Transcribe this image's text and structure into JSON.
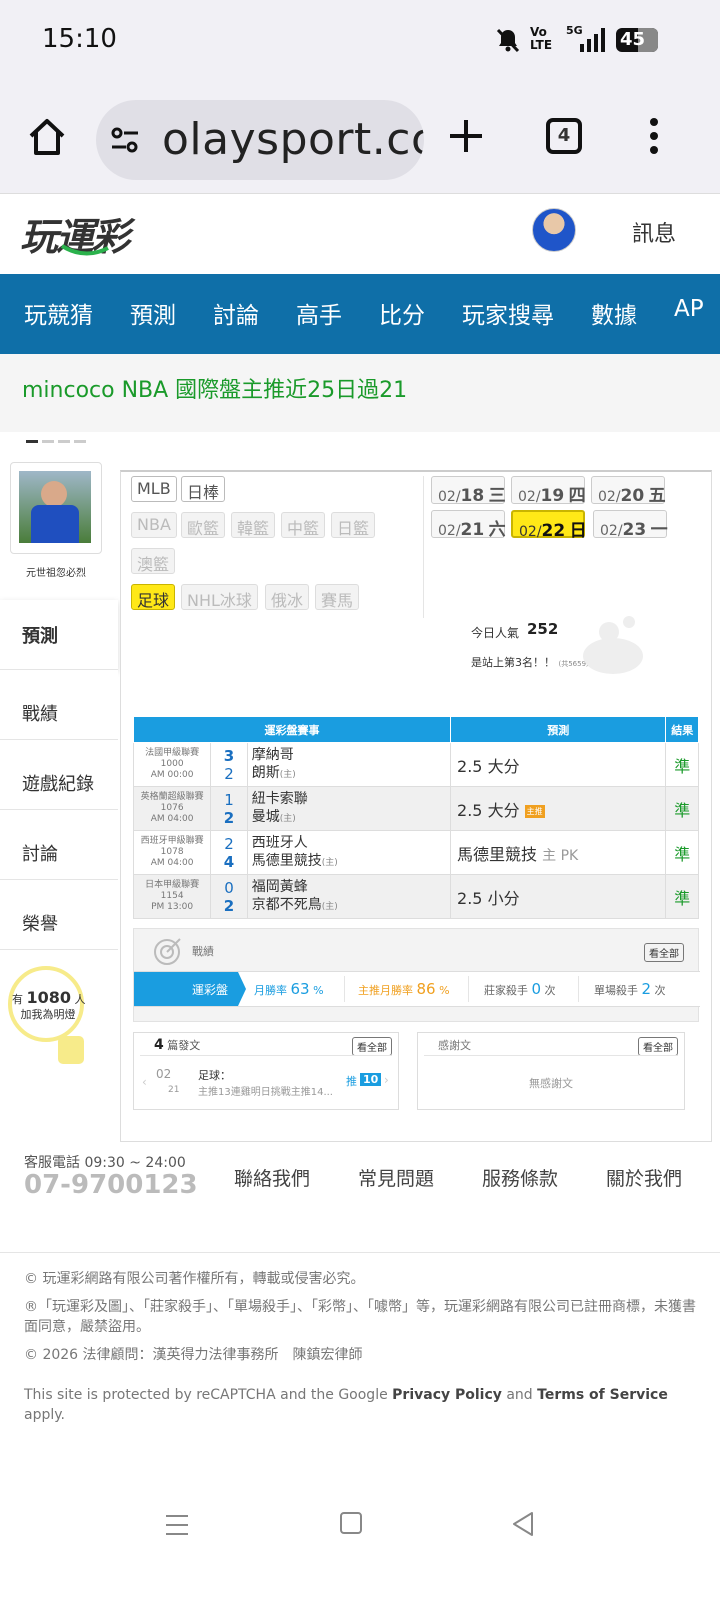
{
  "status": {
    "time": "15:10",
    "battery": "45",
    "network": "5G",
    "volte": "Vo LTE"
  },
  "browser": {
    "url": "olaysport.cc",
    "tabs_count": "4"
  },
  "site": {
    "logo": "玩運彩",
    "messages_label": "訊息"
  },
  "nav": {
    "items": [
      "玩競猜",
      "預測",
      "討論",
      "高手",
      "比分",
      "玩家搜尋",
      "數據",
      "AP"
    ]
  },
  "marquee": {
    "text": "mincoco NBA 國際盤主推近25日過21"
  },
  "sidebar": {
    "username": "元世祖忽必烈",
    "items": [
      "預測",
      "戰績",
      "遊戲紀錄",
      "討論",
      "榮譽"
    ],
    "lamp_prefix": "有",
    "lamp_count": "1080",
    "lamp_suffix": "人",
    "lamp_caption": "加我為明燈"
  },
  "sports": {
    "tags": [
      "MLB",
      "日棒",
      "NBA",
      "歐籃",
      "韓籃",
      "中籃",
      "日籃",
      "澳籃",
      "足球",
      "NHL冰球",
      "俄冰",
      "賽馬"
    ],
    "selected": "足球"
  },
  "dates": [
    {
      "md": "02/",
      "d": "18",
      "w": "三"
    },
    {
      "md": "02/",
      "d": "19",
      "w": "四"
    },
    {
      "md": "02/",
      "d": "20",
      "w": "五"
    },
    {
      "md": "02/",
      "d": "21",
      "w": "六"
    },
    {
      "md": "02/",
      "d": "22",
      "w": "日"
    },
    {
      "md": "02/",
      "d": "23",
      "w": "一"
    }
  ],
  "popularity": {
    "label": "今日人氣",
    "value": "252",
    "rank_text": "是站上第3名！！",
    "total": "(共5659人)"
  },
  "table": {
    "headers": [
      "運彩盤賽事",
      "預測",
      "結果"
    ],
    "rows": [
      {
        "league": "法國甲級聯賽",
        "code": "1000",
        "time": "AM 00:00",
        "s1": "3",
        "s2": "2",
        "t1": "摩納哥",
        "t2": "朗斯",
        "home": "(主)",
        "pick": "2.5 大分",
        "badge": "",
        "result": "準"
      },
      {
        "league": "英格蘭超級聯賽",
        "code": "1076",
        "time": "AM 04:00",
        "s1": "1",
        "s2": "2",
        "t1": "紐卡索聯",
        "t2": "曼城",
        "home": "(主)",
        "pick": "2.5 大分",
        "badge": "主推",
        "result": "準"
      },
      {
        "league": "西班牙甲級聯賽",
        "code": "1078",
        "time": "AM 04:00",
        "s1": "2",
        "s2": "4",
        "t1": "西班牙人",
        "t2": "馬德里競技",
        "home": "(主)",
        "pick": "馬德里競技",
        "pick_extra": "主 PK",
        "badge": "",
        "result": "準"
      },
      {
        "league": "日本甲級聯賽",
        "code": "1154",
        "time": "PM 13:00",
        "s1": "0",
        "s2": "2",
        "t1": "福岡黃蜂",
        "t2": "京都不死鳥",
        "home": "(主)",
        "pick": "2.5 小分",
        "badge": "",
        "result": "準"
      }
    ]
  },
  "record": {
    "title": "戰績",
    "see_all": "看全部",
    "tab": "運彩盤",
    "month_win_label": "月勝率",
    "month_win": "63",
    "main_win_label": "主推月勝率",
    "main_win": "86",
    "pct": "%",
    "bank_label": "莊家殺手",
    "bank": "0",
    "single_label": "單場殺手",
    "single": "2",
    "times": "次"
  },
  "posts": {
    "count": "4",
    "label": "篇發文",
    "see_all": "看全部",
    "date_md": "02",
    "date_d": "21",
    "cat": "足球：",
    "title": "主推13連雞明日挑戰主推14...",
    "push": "推",
    "push_count": "10"
  },
  "thanks": {
    "label": "感謝文",
    "see_all": "看全部",
    "empty": "無感謝文"
  },
  "footer": {
    "phone_label": "客服電話 09:30 ~ 24:00",
    "phone": "07-9700123",
    "links": [
      "聯絡我們",
      "常見問題",
      "服務條款",
      "關於我們"
    ]
  },
  "copyright": {
    "line1": "© 玩運彩網路有限公司著作權所有，轉載或侵害必究。",
    "line2": "®「玩運彩及圖」、「莊家殺手」、「單場殺手」、「彩幣」、「噱幣」等，玩運彩網路有限公司已註冊商標，未獲書面同意，嚴禁盜用。",
    "line3": "© 2026 法律顧問：漢英得力法律事務所　陳鎮宏律師",
    "recaptcha_pre": "This site is protected by reCAPTCHA and the Google ",
    "privacy": "Privacy Policy",
    "and": " and ",
    "terms": "Terms of Service",
    "apply": " apply."
  },
  "colors": {
    "nav": "#0f6fa8",
    "accent": "#1a9de0",
    "marquee": "#1a9a2a",
    "selected": "#ffe817",
    "orange": "#f0a020"
  }
}
